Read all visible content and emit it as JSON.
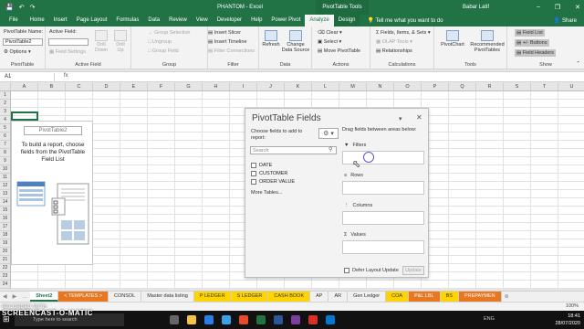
{
  "title_bar": {
    "document_title": "PHANTOM  -  Excel",
    "context_title": "PivotTable Tools",
    "user_name": "Babar Latif"
  },
  "tabs": [
    {
      "label": "File"
    },
    {
      "label": "Home"
    },
    {
      "label": "Insert"
    },
    {
      "label": "Page Layout"
    },
    {
      "label": "Formulas"
    },
    {
      "label": "Data"
    },
    {
      "label": "Review"
    },
    {
      "label": "View"
    },
    {
      "label": "Developer"
    },
    {
      "label": "Help"
    },
    {
      "label": "Power Pivot"
    },
    {
      "label": "Analyze",
      "active": true
    },
    {
      "label": "Design"
    }
  ],
  "tell_me": "Tell me what you want to do",
  "share_label": "Share",
  "ribbon": {
    "pivottable": {
      "name_label": "PivotTable Name:",
      "name_value": "PivotTable2",
      "options": "Options",
      "group": "PivotTable"
    },
    "active_field": {
      "label": "Active Field:",
      "field_settings": "Field Settings",
      "drill_down": "Drill Down",
      "drill_up": "Drill Up",
      "group": "Active Field"
    },
    "group_grp": {
      "group_selection": "Group Selection",
      "ungroup": "Ungroup",
      "group_field": "Group Field",
      "group": "Group"
    },
    "filter": {
      "insert_slicer": "Insert Slicer",
      "insert_timeline": "Insert Timeline",
      "filter_connections": "Filter Connections",
      "group": "Filter"
    },
    "data": {
      "refresh": "Refresh",
      "change_source": "Change Data Source",
      "group": "Data"
    },
    "actions": {
      "clear": "Clear",
      "select": "Select",
      "move": "Move PivotTable",
      "group": "Actions"
    },
    "calculations": {
      "fields_items": "Fields, Items, & Sets",
      "olap": "OLAP Tools",
      "relationships": "Relationships",
      "group": "Calculations"
    },
    "tools": {
      "pivotchart": "PivotChart",
      "recommended": "Recommended PivotTables",
      "group": "Tools"
    },
    "show": {
      "field_list": "Field List",
      "buttons": "+/- Buttons",
      "field_headers": "Field Headers",
      "group": "Show"
    }
  },
  "name_box": "A1",
  "fx_label": "fx",
  "columns": [
    "A",
    "B",
    "C",
    "D",
    "E",
    "F",
    "G",
    "H",
    "I",
    "J",
    "K",
    "L",
    "M",
    "N",
    "O",
    "P",
    "Q",
    "R",
    "S",
    "T",
    "U",
    "V"
  ],
  "rows": [
    "1",
    "2",
    "3",
    "4",
    "5",
    "6",
    "7",
    "8",
    "9",
    "10",
    "11",
    "12",
    "13",
    "14",
    "15",
    "16",
    "17",
    "18",
    "19",
    "20",
    "21",
    "22",
    "23",
    "24"
  ],
  "pivot_placeholder": {
    "name": "PivotTable2",
    "message": "To build a report, choose fields from the PivotTable Field List"
  },
  "field_panel": {
    "title": "PivotTable Fields",
    "choose_label": "Choose fields to add to report:",
    "search_placeholder": "Search",
    "fields": [
      "DATE",
      "CUSTOMER",
      "ORDER VALUE"
    ],
    "more_tables": "More Tables...",
    "drag_label": "Drag fields between areas below:",
    "areas": [
      "Filters",
      "Rows",
      "Columns",
      "Values"
    ],
    "defer_label": "Defer Layout Update",
    "update_label": "Update"
  },
  "sheets": [
    {
      "label": "Sheet2",
      "style": "active"
    },
    {
      "label": "< TEMPLATES >",
      "style": "orange"
    },
    {
      "label": "CONSOL",
      "style": ""
    },
    {
      "label": "Master data listing",
      "style": ""
    },
    {
      "label": "P LEDGER",
      "style": "yellow"
    },
    {
      "label": "S LEDGER",
      "style": "yellow"
    },
    {
      "label": "CASH BOOK",
      "style": "yellow"
    },
    {
      "label": "AP",
      "style": ""
    },
    {
      "label": "AR",
      "style": ""
    },
    {
      "label": "Gen Ledger",
      "style": ""
    },
    {
      "label": "COA",
      "style": "yellow"
    },
    {
      "label": "P&L LBL",
      "style": "orange"
    },
    {
      "label": "BS",
      "style": "yellow"
    },
    {
      "label": "PREPAYMEN",
      "style": "orange"
    }
  ],
  "status": {
    "zoom": "100%"
  },
  "taskbar": {
    "search_placeholder": "Type here to search",
    "time": "18:41",
    "date": "28/07/2020",
    "lang": "ENG"
  },
  "watermark": {
    "top": "RECORDED WITH",
    "main": "SCREENCAST-O-MATIC"
  },
  "colors": {
    "excel_green": "#217346",
    "orange_tab": "#e87722",
    "yellow_tab": "#ffd400"
  }
}
